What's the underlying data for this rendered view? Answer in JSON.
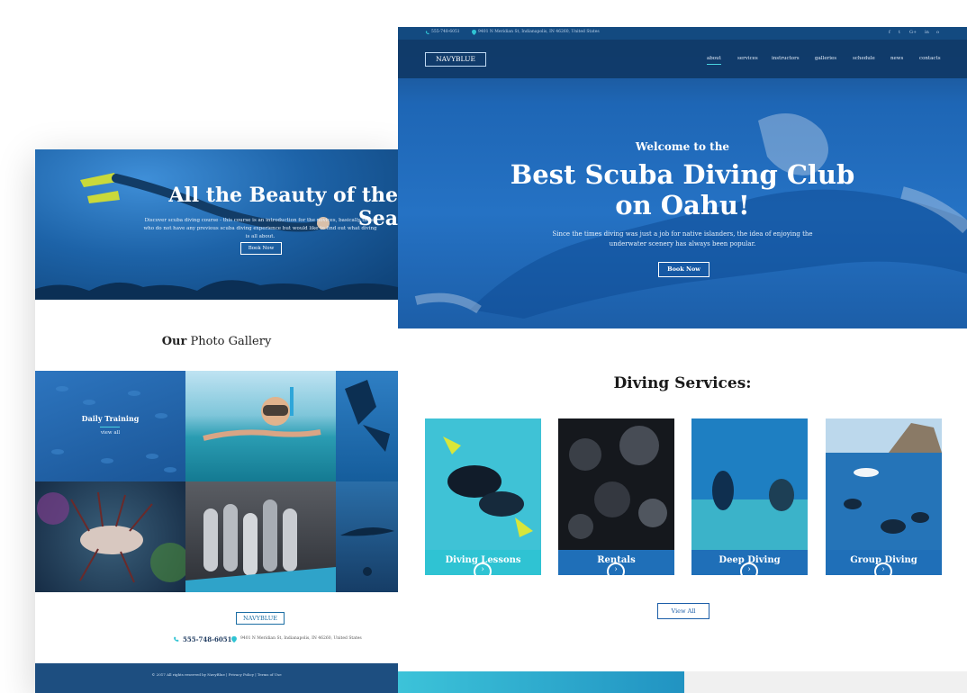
{
  "left": {
    "hero": {
      "title": "All the Beauty of the Sea",
      "text": "Discover scuba diving course - this course is an introduction for the novices, basically those who do not have any previous scuba diving experience but would like to find out what diving is all about.",
      "button": "Book Now"
    },
    "gallery": {
      "title_bold": "Our",
      "title_rest": " Photo Gallery",
      "tile_title": "Daily Training",
      "tile_link": "view all"
    },
    "footer": {
      "logo": "NAVYBLUE",
      "phone": "555-748-6051",
      "address": "9401 N Meridian St, Indianapolis, IN 46260, United States",
      "copyright": "© 2017 All rights reserved by NavyBlue  |  Privacy Policy  |  Terms of Use"
    }
  },
  "right": {
    "topbar": {
      "phone": "555-748-6051",
      "address": "9401 N Meridian St, Indianapolis, IN 46260, United States",
      "social": [
        "f",
        "t",
        "G+",
        "in",
        "o"
      ]
    },
    "nav": {
      "logo": "NAVYBLUE",
      "items": [
        "about",
        "services",
        "instructors",
        "galleries",
        "schedule",
        "news",
        "contacts"
      ],
      "active": "about"
    },
    "hero": {
      "welcome": "Welcome to the",
      "title_line1": "Best Scuba Diving Club",
      "title_line2": "on Oahu!",
      "subtitle": "Since the times diving was just a job for native islanders, the idea of enjoying the underwater scenery has always been popular.",
      "button": "Book Now"
    },
    "services": {
      "title": "Diving Services:",
      "cards": [
        {
          "label": "Diving Lessons",
          "color": "#2fc3d3"
        },
        {
          "label": "Rentals",
          "color": "#1f6fb8"
        },
        {
          "label": "Deep Diving",
          "color": "#1f6fb8"
        },
        {
          "label": "Group Diving",
          "color": "#1f6fb8"
        }
      ],
      "view_all": "View All"
    }
  },
  "colors": {
    "navy": "#134a80",
    "accent": "#2fc3d3",
    "brand_blue": "#1f6fb8"
  }
}
